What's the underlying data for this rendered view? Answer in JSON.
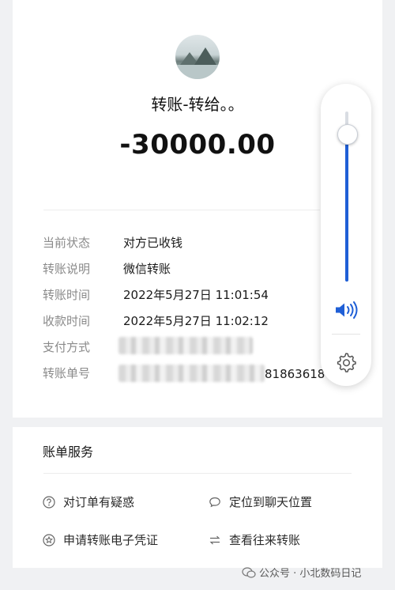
{
  "header": {
    "title": "转账-转给。。",
    "amount": "-30000.00"
  },
  "details": [
    {
      "label": "当前状态",
      "value": "对方已收钱"
    },
    {
      "label": "转账说明",
      "value": "微信转账"
    },
    {
      "label": "转账时间",
      "value": "2022年5月27日 11:01:54"
    },
    {
      "label": "收款时间",
      "value": "2022年5月27日 11:02:12"
    },
    {
      "label": "支付方式",
      "value": ""
    },
    {
      "label": "转账单号",
      "value": "81863618"
    }
  ],
  "services": {
    "title": "账单服务",
    "items": [
      {
        "label": "对订单有疑惑",
        "icon": "question-icon"
      },
      {
        "label": "定位到聊天位置",
        "icon": "chat-bubble-icon"
      },
      {
        "label": "申请转账电子凭证",
        "icon": "star-badge-icon"
      },
      {
        "label": "查看往来转账",
        "icon": "swap-arrows-icon"
      }
    ]
  },
  "volume": {
    "level": 0.87,
    "accent": "#1f5fd6",
    "icons": [
      "speaker-icon",
      "gear-icon"
    ]
  },
  "watermark": {
    "text": "公众号 · 小北数码日记"
  }
}
